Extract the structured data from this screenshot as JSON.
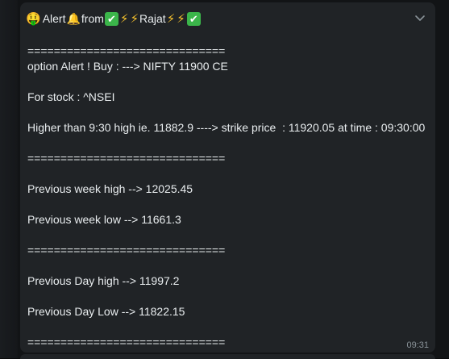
{
  "message": {
    "header": {
      "emoji_money": "🤑",
      "word_alert": "Alert",
      "emoji_bell": "🔔",
      "word_from": "from",
      "emoji_check": "✔",
      "emoji_bolt": "⚡",
      "word_rajat": "Rajat"
    },
    "lines": {
      "sep1": "==============================",
      "l1": "option Alert ! Buy : ---> NIFTY 11900 CE",
      "l2": "For stock : ^NSEI",
      "l3": "Higher than 9:30 high ie. 11882.9 ----> strike price  : 11920.05 at time : 09:30:00",
      "sep2": "==============================",
      "l4": "Previous week high --> 12025.45",
      "l5": "Previous week low --> 11661.3",
      "sep3": "==============================",
      "l6": "Previous Day high --> 11997.2",
      "l7": "Previous Day Low --> 11822.15",
      "sep4": "=============================="
    },
    "timestamp": "09:31"
  },
  "icons": {
    "menu": "chevron-down-icon"
  },
  "colors": {
    "bubble": "#202326",
    "text": "#e9edef",
    "timestamp": "#8a9399",
    "check": "#3bb54a",
    "bolt": "#f6c22e"
  }
}
